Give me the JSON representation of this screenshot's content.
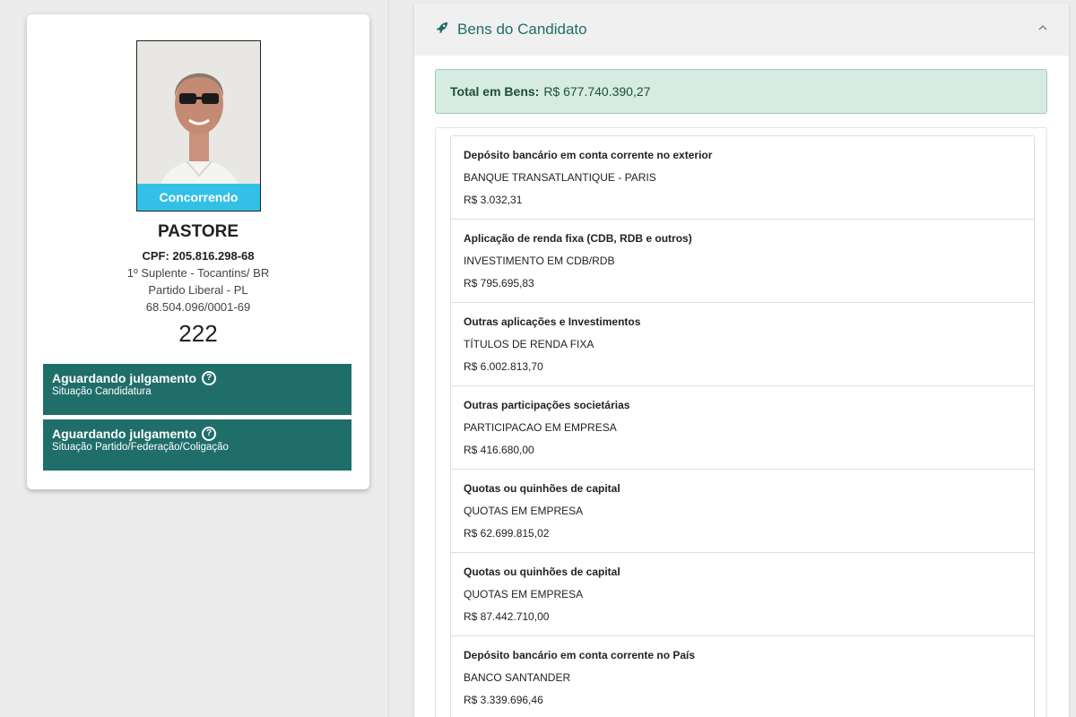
{
  "candidate": {
    "status_chip": "Concorrendo",
    "name": "PASTORE",
    "cpf": "CPF: 205.816.298-68",
    "office": "1º Suplente - Tocantins/ BR",
    "party": "Partido Liberal - PL",
    "party_cnpj": "68.504.096/0001-69",
    "number": "222"
  },
  "situations": [
    {
      "title": "Aguardando julgamento",
      "subtitle": "Situação Candidatura"
    },
    {
      "title": "Aguardando julgamento",
      "subtitle": "Situação Partido/Federação/Coligação"
    }
  ],
  "assets_panel": {
    "title": "Bens do Candidato",
    "total_label": "Total em Bens:",
    "total_value": "R$ 677.740.390,27",
    "items": [
      {
        "type": "Depósito bancário em conta corrente no exterior",
        "description": "BANQUE TRANSATLANTIQUE - PARIS",
        "value": "R$ 3.032,31"
      },
      {
        "type": "Aplicação de renda fixa (CDB, RDB e outros)",
        "description": "INVESTIMENTO EM CDB/RDB",
        "value": "R$ 795.695,83"
      },
      {
        "type": "Outras aplicações e Investimentos",
        "description": "TÍTULOS DE RENDA FIXA",
        "value": "R$ 6.002.813,70"
      },
      {
        "type": "Outras participações societárias",
        "description": "PARTICIPACAO EM EMPRESA",
        "value": "R$ 416.680,00"
      },
      {
        "type": "Quotas ou quinhões de capital",
        "description": "QUOTAS EM EMPRESA",
        "value": "R$ 62.699.815,02"
      },
      {
        "type": "Quotas ou quinhões de capital",
        "description": "QUOTAS EM EMPRESA",
        "value": "R$ 87.442.710,00"
      },
      {
        "type": "Depósito bancário em conta corrente no País",
        "description": "BANCO SANTANDER",
        "value": "R$ 3.339.696,46"
      }
    ]
  },
  "icons": {
    "help": "question-circle-icon",
    "panel": "rocket-icon",
    "collapse": "chevron-up-icon"
  },
  "colors": {
    "teal": "#1f6e6a",
    "chip": "#33c0e6",
    "total_bg": "#d6ebe2"
  }
}
